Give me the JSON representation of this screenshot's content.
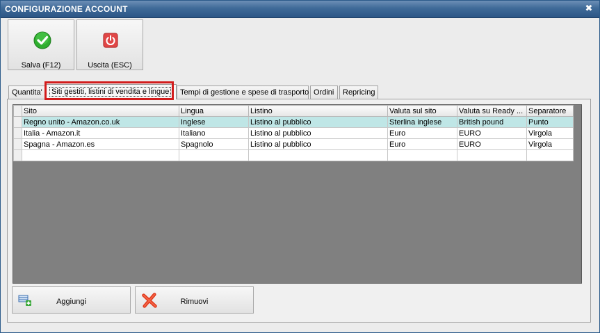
{
  "window": {
    "title": "CONFIGURAZIONE ACCOUNT",
    "close_glyph": "✖"
  },
  "toolbar": {
    "save_label": "Salva (F12)",
    "exit_label": "Uscita (ESC)"
  },
  "tabs": [
    {
      "label": "Quantita'"
    },
    {
      "label": "Siti gestiti, listini di vendita e lingue"
    },
    {
      "label": "Tempi di gestione e spese di trasporto"
    },
    {
      "label": "Ordini"
    },
    {
      "label": "Repricing"
    }
  ],
  "grid": {
    "columns": [
      "Sito",
      "Lingua",
      "Listino",
      "Valuta sul sito",
      "Valuta su Ready ...",
      "Separatore"
    ],
    "rows": [
      [
        "Regno unito - Amazon.co.uk",
        "Inglese",
        "Listino al pubblico",
        "Sterlina inglese",
        "British pound",
        "Punto"
      ],
      [
        "Italia - Amazon.it",
        "Italiano",
        "Listino al pubblico",
        "Euro",
        "EURO",
        "Virgola"
      ],
      [
        "Spagna - Amazon.es",
        "Spagnolo",
        "Listino al pubblico",
        "Euro",
        "EURO",
        "Virgola"
      ]
    ]
  },
  "actions": {
    "add_label": "Aggiungi",
    "remove_label": "Rimuovi"
  },
  "colors": {
    "selected_row": "#bfe6e6",
    "highlight": "#d21c1c",
    "titlebar": "#3f6a98"
  }
}
